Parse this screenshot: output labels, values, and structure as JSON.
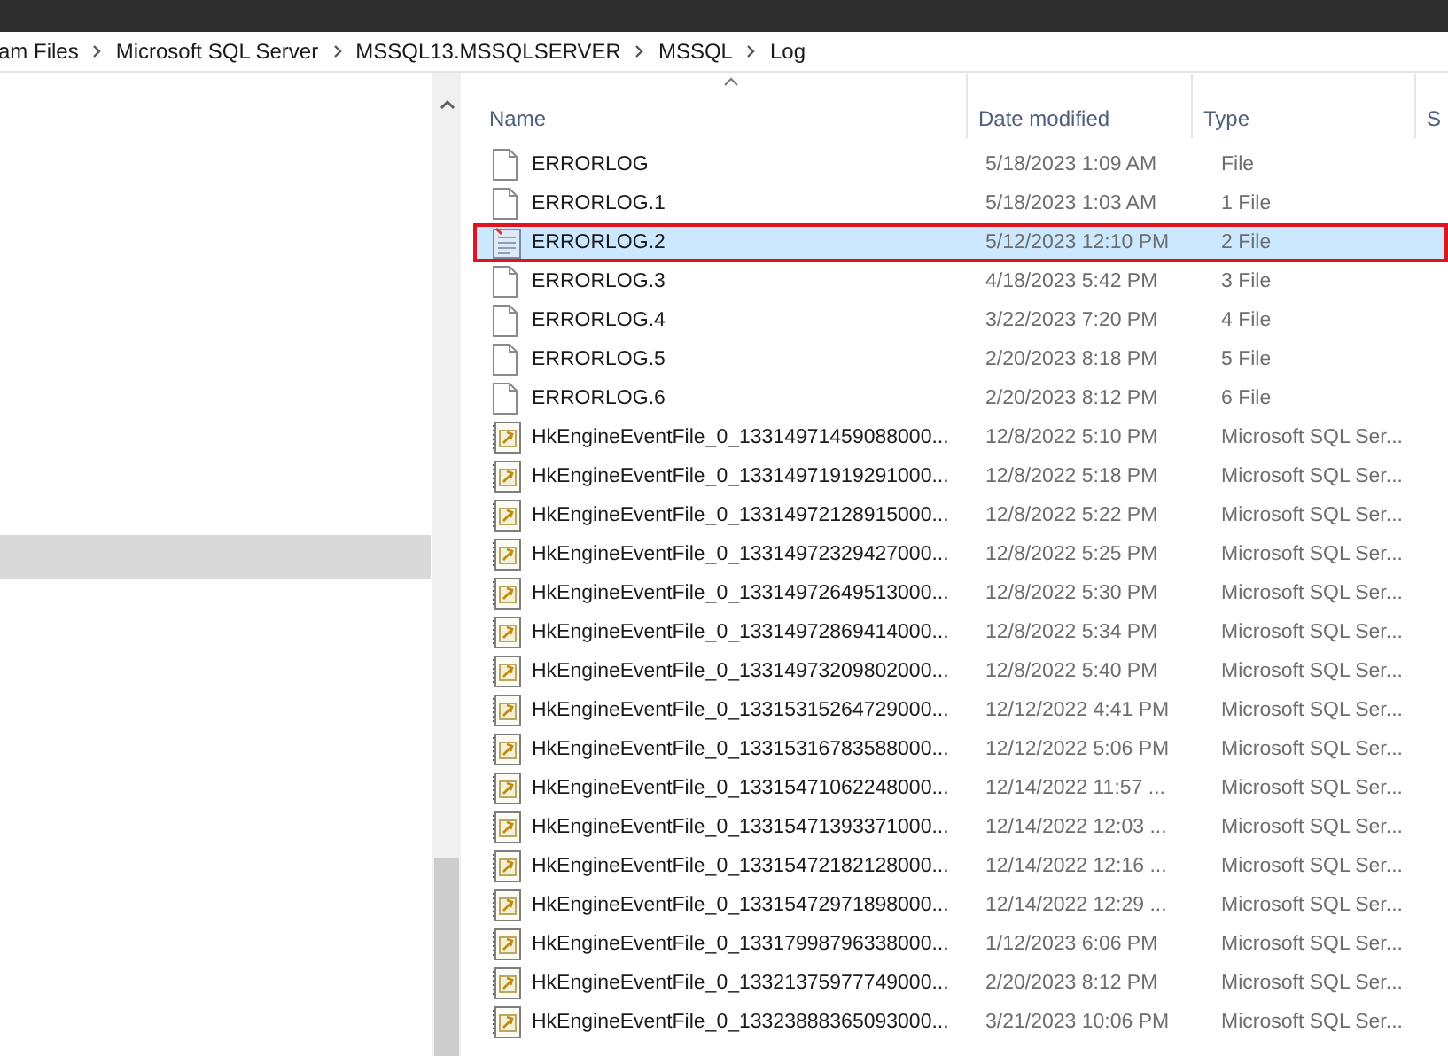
{
  "address_bar": {
    "path": [
      "am Files",
      "Microsoft SQL Server",
      "MSSQL13.MSSQLSERVER",
      "MSSQL",
      "Log"
    ]
  },
  "navigation_pane": {
    "items": [
      {
        "selected": true
      }
    ]
  },
  "file_list": {
    "columns": [
      {
        "label": "Name",
        "sorted": true
      },
      {
        "label": "Date modified",
        "sorted": false
      },
      {
        "label": "Type",
        "sorted": false
      },
      {
        "label": "S",
        "sorted": false
      }
    ],
    "files": [
      {
        "kind": "file",
        "name": "ERRORLOG",
        "date": "5/18/2023 1:09 AM",
        "type": "File",
        "selected": false,
        "annotated": false
      },
      {
        "kind": "file",
        "name": "ERRORLOG.1",
        "date": "5/18/2023 1:03 AM",
        "type": "1 File",
        "selected": false,
        "annotated": false
      },
      {
        "kind": "text",
        "name": "ERRORLOG.2",
        "date": "5/12/2023 12:10 PM",
        "type": "2 File",
        "selected": true,
        "annotated": true
      },
      {
        "kind": "file",
        "name": "ERRORLOG.3",
        "date": "4/18/2023 5:42 PM",
        "type": "3 File",
        "selected": false,
        "annotated": false
      },
      {
        "kind": "file",
        "name": "ERRORLOG.4",
        "date": "3/22/2023 7:20 PM",
        "type": "4 File",
        "selected": false,
        "annotated": false
      },
      {
        "kind": "file",
        "name": "ERRORLOG.5",
        "date": "2/20/2023 8:18 PM",
        "type": "5 File",
        "selected": false,
        "annotated": false
      },
      {
        "kind": "file",
        "name": "ERRORLOG.6",
        "date": "2/20/2023 8:12 PM",
        "type": "6 File",
        "selected": false,
        "annotated": false
      },
      {
        "kind": "event",
        "name": "HkEngineEventFile_0_13314971459088000...",
        "date": "12/8/2022 5:10 PM",
        "type": "Microsoft SQL Ser...",
        "selected": false,
        "annotated": false
      },
      {
        "kind": "event",
        "name": "HkEngineEventFile_0_13314971919291000...",
        "date": "12/8/2022 5:18 PM",
        "type": "Microsoft SQL Ser...",
        "selected": false,
        "annotated": false
      },
      {
        "kind": "event",
        "name": "HkEngineEventFile_0_13314972128915000...",
        "date": "12/8/2022 5:22 PM",
        "type": "Microsoft SQL Ser...",
        "selected": false,
        "annotated": false
      },
      {
        "kind": "event",
        "name": "HkEngineEventFile_0_13314972329427000...",
        "date": "12/8/2022 5:25 PM",
        "type": "Microsoft SQL Ser...",
        "selected": false,
        "annotated": false
      },
      {
        "kind": "event",
        "name": "HkEngineEventFile_0_13314972649513000...",
        "date": "12/8/2022 5:30 PM",
        "type": "Microsoft SQL Ser...",
        "selected": false,
        "annotated": false
      },
      {
        "kind": "event",
        "name": "HkEngineEventFile_0_13314972869414000...",
        "date": "12/8/2022 5:34 PM",
        "type": "Microsoft SQL Ser...",
        "selected": false,
        "annotated": false
      },
      {
        "kind": "event",
        "name": "HkEngineEventFile_0_13314973209802000...",
        "date": "12/8/2022 5:40 PM",
        "type": "Microsoft SQL Ser...",
        "selected": false,
        "annotated": false
      },
      {
        "kind": "event",
        "name": "HkEngineEventFile_0_13315315264729000...",
        "date": "12/12/2022 4:41 PM",
        "type": "Microsoft SQL Ser...",
        "selected": false,
        "annotated": false
      },
      {
        "kind": "event",
        "name": "HkEngineEventFile_0_13315316783588000...",
        "date": "12/12/2022 5:06 PM",
        "type": "Microsoft SQL Ser...",
        "selected": false,
        "annotated": false
      },
      {
        "kind": "event",
        "name": "HkEngineEventFile_0_13315471062248000...",
        "date": "12/14/2022 11:57 ...",
        "type": "Microsoft SQL Ser...",
        "selected": false,
        "annotated": false
      },
      {
        "kind": "event",
        "name": "HkEngineEventFile_0_13315471393371000...",
        "date": "12/14/2022 12:03 ...",
        "type": "Microsoft SQL Ser...",
        "selected": false,
        "annotated": false
      },
      {
        "kind": "event",
        "name": "HkEngineEventFile_0_13315472182128000...",
        "date": "12/14/2022 12:16 ...",
        "type": "Microsoft SQL Ser...",
        "selected": false,
        "annotated": false
      },
      {
        "kind": "event",
        "name": "HkEngineEventFile_0_13315472971898000...",
        "date": "12/14/2022 12:29 ...",
        "type": "Microsoft SQL Ser...",
        "selected": false,
        "annotated": false
      },
      {
        "kind": "event",
        "name": "HkEngineEventFile_0_13317998796338000...",
        "date": "1/12/2023 6:06 PM",
        "type": "Microsoft SQL Ser...",
        "selected": false,
        "annotated": false
      },
      {
        "kind": "event",
        "name": "HkEngineEventFile_0_13321375977749000...",
        "date": "2/20/2023 8:12 PM",
        "type": "Microsoft SQL Ser...",
        "selected": false,
        "annotated": false
      },
      {
        "kind": "event",
        "name": "HkEngineEventFile_0_13323888365093000...",
        "date": "3/21/2023 10:06 PM",
        "type": "Microsoft SQL Ser...",
        "selected": false,
        "annotated": false
      }
    ]
  }
}
